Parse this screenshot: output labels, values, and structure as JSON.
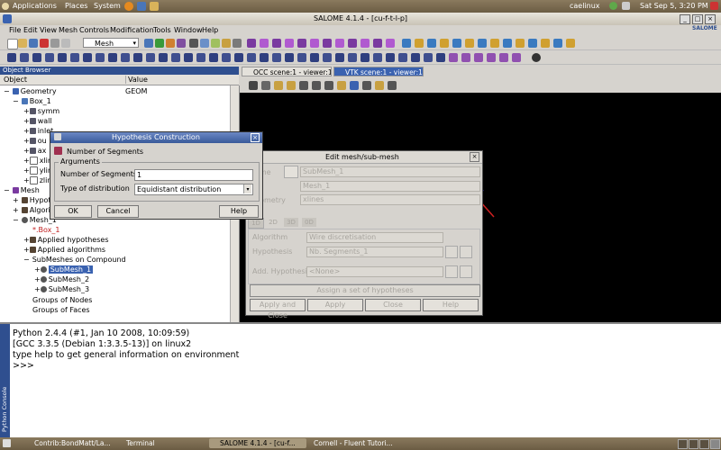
{
  "gnome_panel": {
    "menus": [
      "Applications",
      "Places",
      "System"
    ],
    "user": "caelinux",
    "datetime": "Sat Sep  5,  3:20 PM"
  },
  "window": {
    "title": "SALOME 4.1.4 - [cu-f-t-l-p]",
    "logo": "SALOME"
  },
  "menu": [
    "File",
    "Edit",
    "View",
    "Mesh",
    "Controls",
    "Modification",
    "Tools",
    "Window",
    "Help"
  ],
  "toolbar": {
    "module_select": "Mesh"
  },
  "object_browser": {
    "title": "Object Browser",
    "col_object": "Object",
    "col_value": "Value",
    "items": [
      {
        "label": "Geometry",
        "value": "GEOM"
      },
      {
        "label": "Box_1"
      },
      {
        "label": "symm"
      },
      {
        "label": "wall"
      },
      {
        "label": "inlet"
      },
      {
        "label": "ou"
      },
      {
        "label": "ax"
      },
      {
        "label": "xlin"
      },
      {
        "label": "ylin"
      },
      {
        "label": "zlin"
      },
      {
        "label": "Mesh"
      },
      {
        "label": "Hypot"
      },
      {
        "label": "Algori"
      },
      {
        "label": "Mesh_1"
      },
      {
        "label": "*.Box_1"
      },
      {
        "label": "Applied hypotheses"
      },
      {
        "label": "Applied algorithms"
      },
      {
        "label": "SubMeshes on Compound"
      },
      {
        "label": "SubMesh_1"
      },
      {
        "label": "SubMesh_2"
      },
      {
        "label": "SubMesh_3"
      },
      {
        "label": "Groups of Nodes"
      },
      {
        "label": "Groups of Faces"
      }
    ]
  },
  "viewer": {
    "tabs": [
      "OCC scene:1 - viewer:1",
      "VTK scene:1 - viewer:1"
    ]
  },
  "console": {
    "side_label": "Python Console",
    "lines": [
      "Python 2.4.4 (#1, Jan 10 2008, 10:09:59)",
      "[GCC 3.3.5 (Debian 1:3.3.5-13)] on linux2",
      "type help to get general information on environment",
      ">>>"
    ]
  },
  "taskbar": [
    "Contrib:BondMatt/La...",
    "Terminal",
    "SALOME 4.1.4 - [cu-f...",
    "Cornell - Fluent Tutori..."
  ],
  "hypothesis_dialog": {
    "title": "Hypothesis Construction",
    "heading": "Number of Segments",
    "group": "Arguments",
    "num_segments_label": "Number of Segments",
    "num_segments_value": "1",
    "distribution_label": "Type of distribution",
    "distribution_value": "Equidistant distribution",
    "ok": "OK",
    "cancel": "Cancel",
    "help": "Help"
  },
  "edit_mesh_dialog": {
    "title": "Edit mesh/sub-mesh",
    "name_label": "Name",
    "name_value": "SubMesh_1",
    "mesh_value": "Mesh_1",
    "geometry_label": "Geometry",
    "geometry_value": "xlines",
    "tabs": [
      "1D",
      "2D",
      "3D",
      "0D"
    ],
    "algorithm_label": "Algorithm",
    "algorithm_value": "Wire discretisation",
    "hypothesis_label": "Hypothesis",
    "hypothesis_value": "Nb. Segments_1",
    "add_hyp_label": "Add. Hypothesis",
    "add_hyp_value": "<None>",
    "assign_set": "Assign a set of hypotheses",
    "buttons": [
      "Apply and Close",
      "Apply",
      "Close",
      "Help"
    ]
  }
}
